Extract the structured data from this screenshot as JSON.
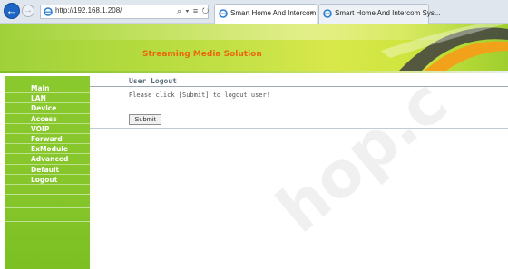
{
  "browser": {
    "url": "http://192.168.1.208/",
    "toolbar_glyphs": "⌕ ▾ ≡ ↻",
    "tabs": [
      {
        "label": "Smart Home And Intercom ...",
        "close": "×"
      },
      {
        "label": "Smart Home And Intercom Sys..."
      }
    ]
  },
  "header": {
    "title": "Streaming Media Solution"
  },
  "sidebar": {
    "items": [
      {
        "label": "Main"
      },
      {
        "label": "LAN"
      },
      {
        "label": "Device"
      },
      {
        "label": "Access"
      },
      {
        "label": "VOIP"
      },
      {
        "label": "Forward"
      },
      {
        "label": "ExModule"
      },
      {
        "label": "Advanced"
      },
      {
        "label": "Default"
      },
      {
        "label": "Logout"
      }
    ]
  },
  "main": {
    "title": "User Logout",
    "message": "Please click [Submit] to logout user!",
    "submit_label": "Submit"
  },
  "watermark": "hop.c",
  "colors": {
    "accent_green": "#86c62a",
    "title_orange": "#e8670e",
    "back_blue": "#1d66c6"
  },
  "icons": [
    "back-arrow-icon",
    "forward-arrow-icon",
    "ie-logo-icon",
    "search-icon",
    "close-icon"
  ]
}
